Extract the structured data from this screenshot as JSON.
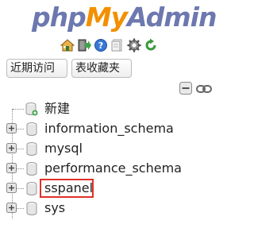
{
  "logo": {
    "part1": "php",
    "part2": "My",
    "part3": "Admin"
  },
  "toolbar_icons": [
    "home-icon",
    "logout-icon",
    "help-icon",
    "docs-icon",
    "settings-icon",
    "reload-icon"
  ],
  "buttons": {
    "recent": "近期访问",
    "favorites": "表收藏夹"
  },
  "tree": {
    "new_label": "新建",
    "databases": [
      {
        "name": "information_schema"
      },
      {
        "name": "mysql"
      },
      {
        "name": "performance_schema"
      },
      {
        "name": "sspanel",
        "highlighted": true
      },
      {
        "name": "sys"
      }
    ]
  },
  "colors": {
    "logo_blue": "#6c78af",
    "logo_orange": "#f29000",
    "highlight": "#e0302a"
  }
}
